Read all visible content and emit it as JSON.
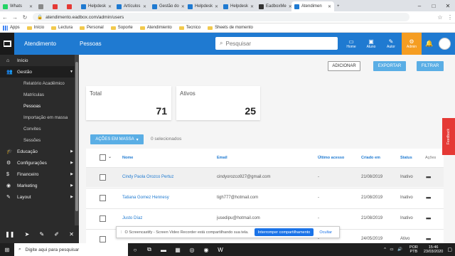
{
  "browser": {
    "tabs": [
      {
        "label": "Whats",
        "color": "#25d366",
        "active": false
      },
      {
        "label": "",
        "color": "#888888",
        "active": false
      },
      {
        "label": "",
        "color": "#e53935",
        "active": false
      },
      {
        "label": "",
        "color": "#e53935",
        "active": false
      },
      {
        "label": "Helpdesk",
        "color": "#1f7ad1",
        "active": false
      },
      {
        "label": "Artículos",
        "color": "#1f7ad1",
        "active": false
      },
      {
        "label": "Gestão do",
        "color": "#1f7ad1",
        "active": false
      },
      {
        "label": "Helpdesk",
        "color": "#1f7ad1",
        "active": false
      },
      {
        "label": "Helpdesk",
        "color": "#1f7ad1",
        "active": false
      },
      {
        "label": "EadboxMe",
        "color": "#333333",
        "active": false
      },
      {
        "label": "Atendimen",
        "color": "#1f7ad1",
        "active": true
      }
    ],
    "url": "atendimento.eadbox.com/admin/users",
    "bookmarks": [
      "Apps",
      "Início",
      "Lectura",
      "Personal",
      "Soporte",
      "Atendimiento",
      "Tecnico",
      "Sheets de momento"
    ]
  },
  "topnav": {
    "brand": "Atendimento",
    "page_title": "Pessoas",
    "search_placeholder": "Pesquisar",
    "links": {
      "home": "Home",
      "aluno": "Aluno",
      "autor": "Autor",
      "admin": "Admin"
    }
  },
  "sidebar": {
    "items": [
      {
        "label": "Início",
        "icon": "home-icon"
      },
      {
        "label": "Gestão",
        "icon": "users-icon"
      },
      {
        "label": "Educação",
        "icon": "graduation-icon"
      },
      {
        "label": "Configurações",
        "icon": "gear-icon"
      },
      {
        "label": "Financeiro",
        "icon": "dollar-icon"
      },
      {
        "label": "Marketing",
        "icon": "pin-icon"
      },
      {
        "label": "Layout",
        "icon": "layout-icon"
      }
    ],
    "gestao_sub": [
      "Relatório Acadêmico",
      "Matrículas",
      "Pessoas",
      "Importação em massa",
      "Convites",
      "Sessões"
    ]
  },
  "actions": {
    "adicionar": "ADICIONAR",
    "exportar": "EXPORTAR",
    "filtrar": "FILTRAR"
  },
  "stats": {
    "total_label": "Total",
    "total_value": "71",
    "ativos_label": "Ativos",
    "ativos_value": "25"
  },
  "bulk": {
    "label": "AÇÕES EM MASSA",
    "selected": "0 selecionados"
  },
  "table": {
    "headers": {
      "nome": "Nome",
      "email": "Email",
      "ultimo": "Último acesso",
      "criado": "Criado em",
      "status": "Status",
      "acoes": "Ações"
    },
    "rows": [
      {
        "nome": "Cindy Paola Orozco Pertuz",
        "email": "cindyorozco927@gmail.com",
        "ultimo": "-",
        "criado": "21/08/2019",
        "status": "Inativo"
      },
      {
        "nome": "Tatiana Gomez Hennesy",
        "email": "tigh777@hotmail.com",
        "ultimo": "-",
        "criado": "21/08/2019",
        "status": "Inativo"
      },
      {
        "nome": "Justo Díaz",
        "email": "jusedipu@hotmail.com",
        "ultimo": "-",
        "criado": "21/08/2019",
        "status": "Inativo"
      },
      {
        "nome": "",
        "email": "",
        "ultimo": "-",
        "criado": "24/05/2019",
        "status": "Ativo"
      }
    ]
  },
  "feedback": "Feedback",
  "share_bar": {
    "text": "O Screencastify - Screen Video Recorder está compartilhando sua tela.",
    "stop": "Interromper compartilhamento",
    "hide": "Ocultar"
  },
  "taskbar": {
    "search": "Digite aqui para pesquisar",
    "lang1": "POR",
    "lang2": "PTB",
    "time": "15:46",
    "date": "23/03/2020"
  }
}
